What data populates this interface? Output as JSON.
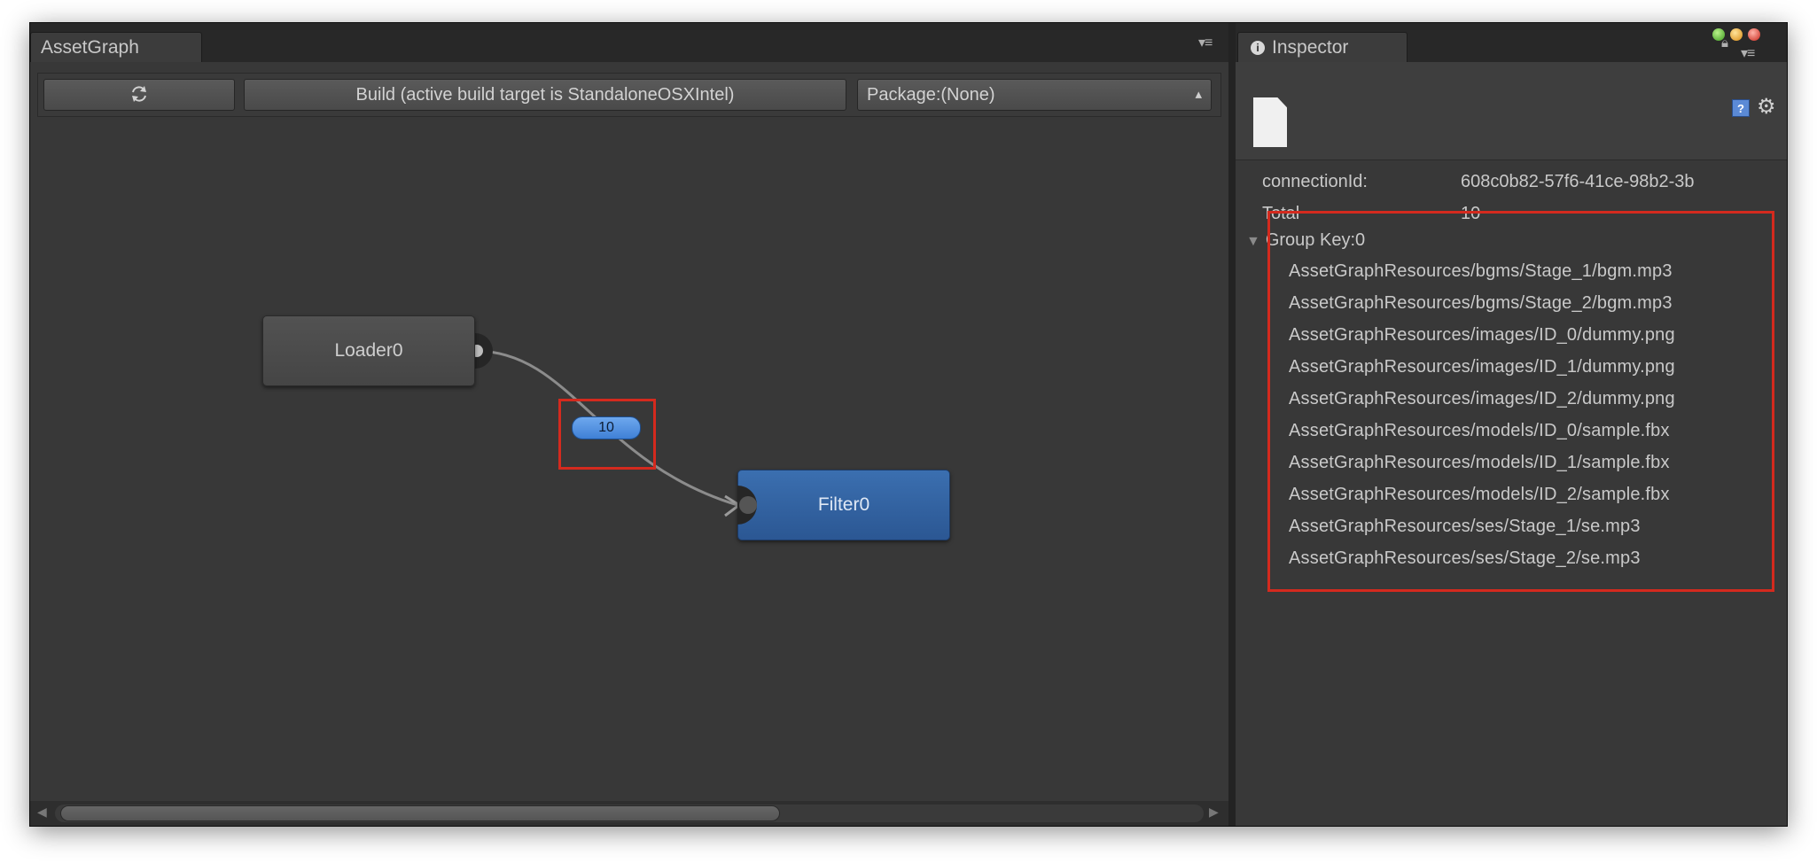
{
  "asset_graph": {
    "tab_label": "AssetGraph",
    "toolbar": {
      "refresh_icon": "refresh-icon",
      "build_label": "Build (active build target is StandaloneOSXIntel)",
      "package_label": "Package:(None)"
    },
    "nodes": {
      "loader_label": "Loader0",
      "filter_label": "Filter0"
    },
    "connection_badge": "10"
  },
  "inspector": {
    "tab_label": "Inspector",
    "properties": [
      {
        "label": "connectionId:",
        "value": "608c0b82-57f6-41ce-98b2-3b"
      },
      {
        "label": "Total",
        "value": "10"
      }
    ],
    "group_header": "Group Key:0",
    "asset_paths": [
      "AssetGraphResources/bgms/Stage_1/bgm.mp3",
      "AssetGraphResources/bgms/Stage_2/bgm.mp3",
      "AssetGraphResources/images/ID_0/dummy.png",
      "AssetGraphResources/images/ID_1/dummy.png",
      "AssetGraphResources/images/ID_2/dummy.png",
      "AssetGraphResources/models/ID_0/sample.fbx",
      "AssetGraphResources/models/ID_1/sample.fbx",
      "AssetGraphResources/models/ID_2/sample.fbx",
      "AssetGraphResources/ses/Stage_1/se.mp3",
      "AssetGraphResources/ses/Stage_2/se.mp3"
    ]
  },
  "colors": {
    "panel_bg": "#383838",
    "filter_node": "#3b6fb0",
    "highlight": "#d42a1e",
    "badge": "#4f8fe0"
  }
}
